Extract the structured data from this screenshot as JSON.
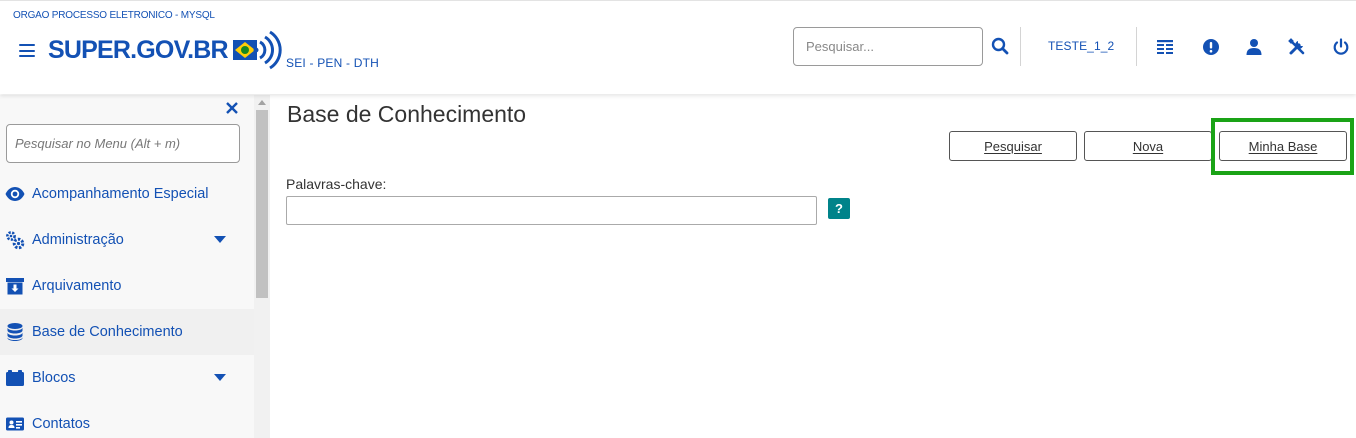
{
  "header": {
    "org_name": "ORGAO PROCESSO ELETRONICO - MYSQL",
    "logo_text": "SUPER",
    "logo_text_suffix": ".GOV.BR",
    "system_tag": "SEI - PEN - DTH",
    "search_placeholder": "Pesquisar...",
    "unit_name": "TESTE_1_2",
    "icons": [
      "menu-icon",
      "search-icon",
      "grid-list-icon",
      "alert-icon",
      "user-icon",
      "tools-icon",
      "power-icon"
    ],
    "accent_color": "#1351b4"
  },
  "sidebar": {
    "search_placeholder": "Pesquisar no Menu (Alt + m)",
    "items": [
      {
        "label": "Acompanhamento Especial",
        "icon": "eye-icon",
        "has_submenu": false
      },
      {
        "label": "Administração",
        "icon": "gears-icon",
        "has_submenu": true
      },
      {
        "label": "Arquivamento",
        "icon": "archive-icon",
        "has_submenu": false
      },
      {
        "label": "Base de Conhecimento",
        "icon": "database-icon",
        "has_submenu": false,
        "active": true
      },
      {
        "label": "Blocos",
        "icon": "blocks-icon",
        "has_submenu": true
      },
      {
        "label": "Contatos",
        "icon": "contact-card-icon",
        "has_submenu": false
      }
    ]
  },
  "main": {
    "title": "Base de Conhecimento",
    "buttons": {
      "pesquisar": "Pesquisar",
      "nova": "Nova",
      "minha_base": "Minha Base"
    },
    "highlight_color": "#1aa316",
    "keywords_label": "Palavras-chave:",
    "keywords_value": "",
    "help_label": "?",
    "help_color": "#00838a"
  }
}
